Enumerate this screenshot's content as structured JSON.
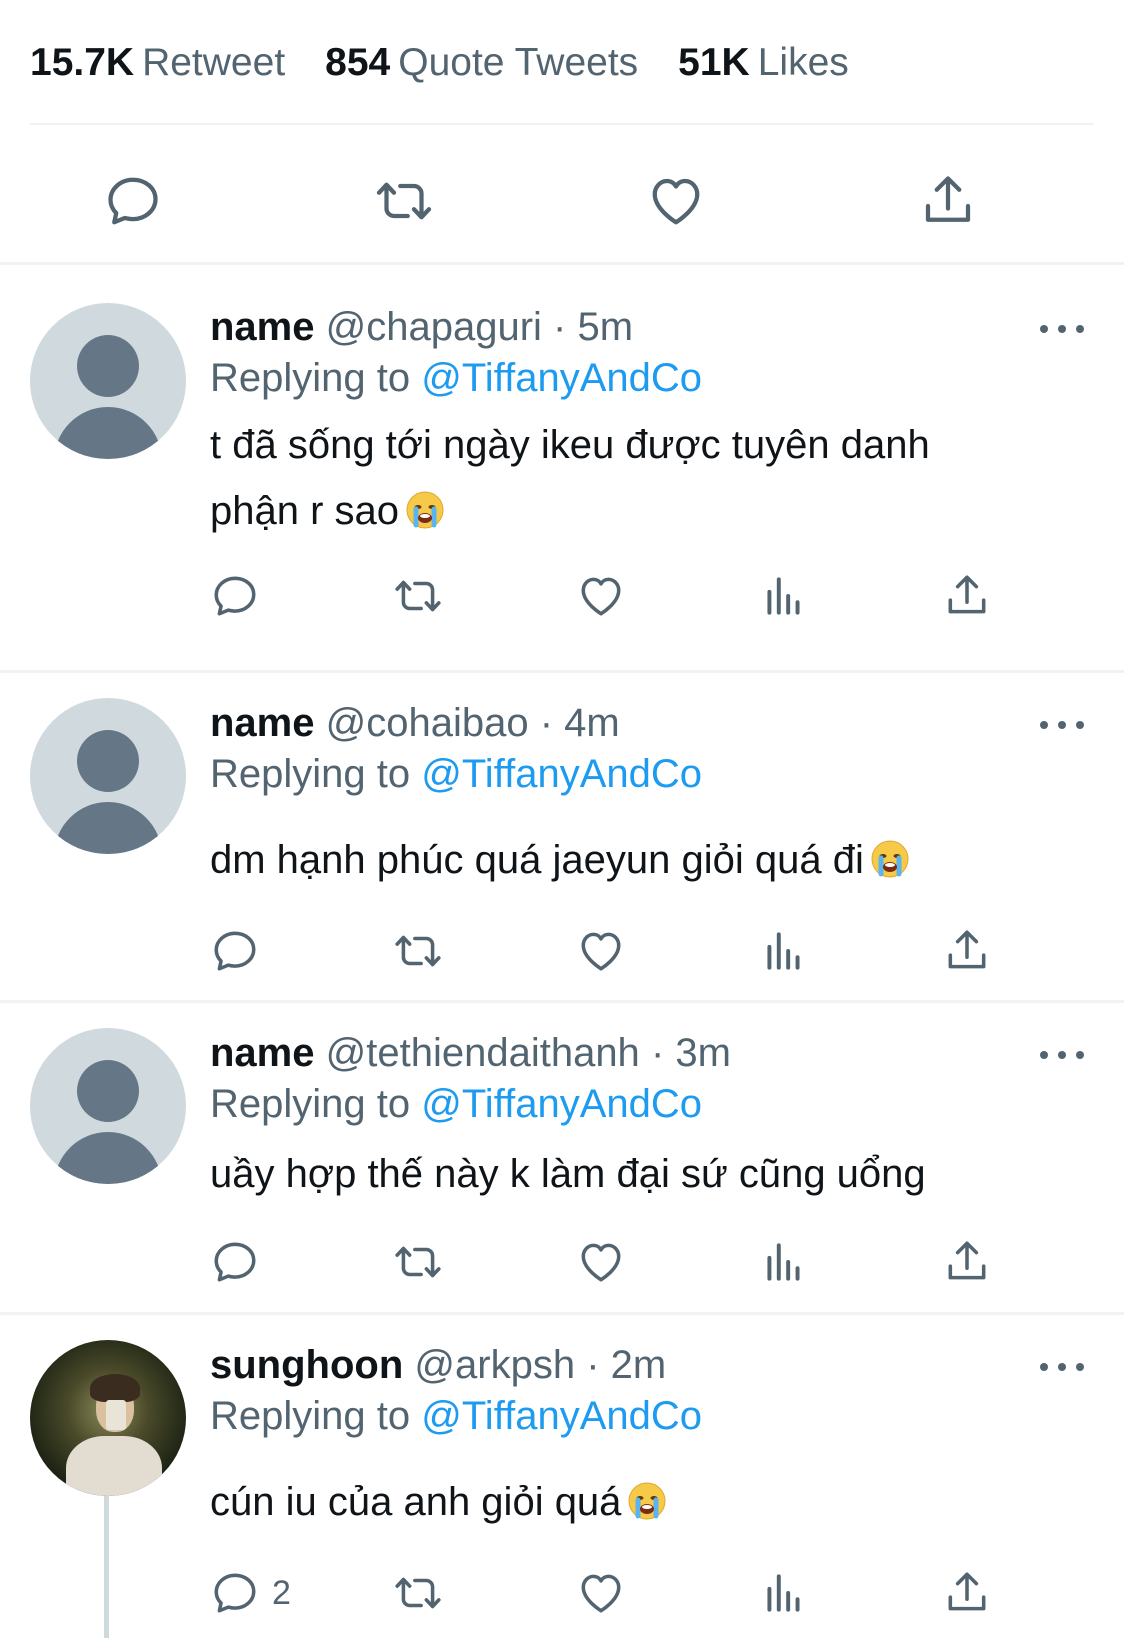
{
  "stats": [
    {
      "number": "15.7K",
      "label": "Retweet"
    },
    {
      "number": "854",
      "label": "Quote Tweets"
    },
    {
      "number": "51K",
      "label": "Likes"
    }
  ],
  "replies": [
    {
      "name": "name",
      "handle": "@chapaguri",
      "time": "· 5m",
      "replying_prefix": "Replying to",
      "replying_to": "@TiffanyAndCo",
      "text_line1": "t đã sống tới ngày ikeu được tuyên danh",
      "text_line2": "phận r sao",
      "has_emoji": true,
      "reply_count": ""
    },
    {
      "name": "name",
      "handle": "@cohaibao",
      "time": "· 4m",
      "replying_prefix": "Replying to",
      "replying_to": "@TiffanyAndCo",
      "text_line1": "dm hạnh phúc quá jaeyun giỏi quá đi",
      "has_emoji": true,
      "reply_count": ""
    },
    {
      "name": "name",
      "handle": "@tethiendaithanh",
      "time": "· 3m",
      "replying_prefix": "Replying to",
      "replying_to": "@TiffanyAndCo",
      "text_line1": "uầy hợp thế này k làm đại sứ cũng uổng",
      "has_emoji": false,
      "reply_count": ""
    },
    {
      "name": "sunghoon",
      "handle": "@arkpsh",
      "time": "· 2m",
      "replying_prefix": "Replying to",
      "replying_to": "@TiffanyAndCo",
      "text_line1": "cún iu của anh giỏi quá",
      "has_emoji": true,
      "reply_count": "2"
    }
  ],
  "icons": {
    "reply": "reply-icon",
    "retweet": "retweet-icon",
    "like": "heart-icon",
    "views": "views-icon",
    "share": "share-icon",
    "more": "more-icon",
    "emoji": "crying-face-emoji"
  },
  "colors": {
    "mention": "#1d9bf0",
    "secondary_text": "#536471",
    "divider": "#eff3f4",
    "avatar_placeholder": "#cfd9de"
  }
}
